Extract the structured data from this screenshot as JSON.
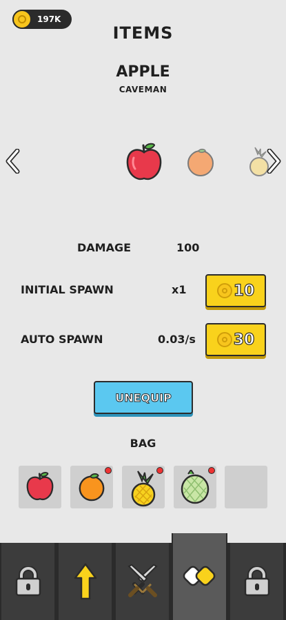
{
  "currency": {
    "amount": "197K",
    "icon": "coin-icon"
  },
  "page": {
    "title": "ITEMS"
  },
  "item": {
    "name": "APPLE",
    "tier": "CAVEMAN"
  },
  "carousel": {
    "items": [
      "apple",
      "orange",
      "pineapple"
    ],
    "selected": "apple"
  },
  "stats": {
    "damage": {
      "label": "DAMAGE",
      "value": "100"
    },
    "initial_spawn": {
      "label": "INITIAL SPAWN",
      "value": "x1",
      "cost": "10"
    },
    "auto_spawn": {
      "label": "AUTO SPAWN",
      "value": "0.03/s",
      "cost": "30"
    }
  },
  "unequip_label": "UNEQUIP",
  "bag": {
    "title": "BAG",
    "slots": [
      {
        "item": "apple",
        "new": false
      },
      {
        "item": "orange",
        "new": true
      },
      {
        "item": "pineapple",
        "new": true
      },
      {
        "item": "melon",
        "new": true
      },
      {
        "item": "",
        "new": false
      }
    ]
  },
  "nav": {
    "tabs": [
      {
        "icon": "lock-icon",
        "active": false
      },
      {
        "icon": "arrow-up-icon",
        "active": false
      },
      {
        "icon": "crossed-swords-icon",
        "active": false
      },
      {
        "icon": "items-icon",
        "active": true
      },
      {
        "icon": "lock-icon",
        "active": false
      }
    ]
  },
  "colors": {
    "background": "#e8e8e8",
    "buy_button": "#f9d21c",
    "unequip_button": "#5bc8f0",
    "nav": "#3c3c3c"
  }
}
